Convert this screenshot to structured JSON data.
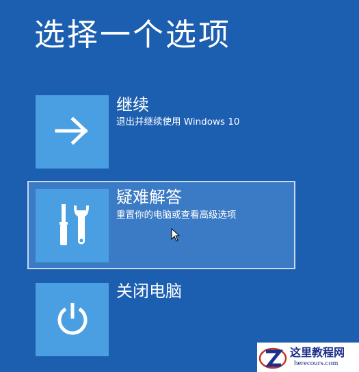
{
  "page": {
    "title": "选择一个选项"
  },
  "options": [
    {
      "name": "继续",
      "description": "退出并继续使用 Windows 10",
      "icon": "arrow-right-icon"
    },
    {
      "name": "疑难解答",
      "description": "重置你的电脑或查看高级选项",
      "icon": "tools-icon"
    },
    {
      "name": "关闭电脑",
      "description": "",
      "icon": "power-icon"
    }
  ],
  "watermark": {
    "title": "这里教程网",
    "url": "herecours.com"
  },
  "colors": {
    "background": "#1c5fb0",
    "tile": "#4a9fe2",
    "selected_background": "#3b7ac4",
    "selected_border": "#c9d9ee"
  }
}
